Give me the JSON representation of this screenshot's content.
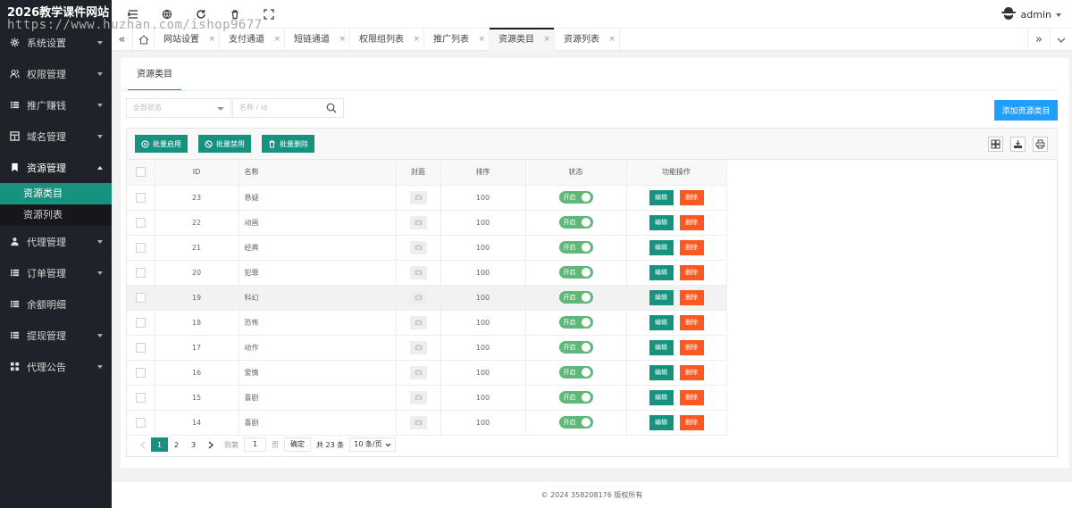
{
  "app": {
    "title": "2026教学课件网站"
  },
  "watermark": "https://www.huzhan.com/ishop9677",
  "user": {
    "name": "admin"
  },
  "sidebar": {
    "items": [
      {
        "label": "系统设置",
        "icon": "gear-icon"
      },
      {
        "label": "权限管理",
        "icon": "users-icon"
      },
      {
        "label": "推广赚钱",
        "icon": "list-icon"
      },
      {
        "label": "域名管理",
        "icon": "grid-icon"
      },
      {
        "label": "资源管理",
        "icon": "bookmark-icon",
        "expanded": true,
        "children": [
          {
            "label": "资源类目",
            "active": true
          },
          {
            "label": "资源列表"
          }
        ]
      },
      {
        "label": "代理管理",
        "icon": "user-group-icon"
      },
      {
        "label": "订单管理",
        "icon": "list-icon"
      },
      {
        "label": "余额明细",
        "icon": "list-icon"
      },
      {
        "label": "提现管理",
        "icon": "list-icon"
      },
      {
        "label": "代理公告",
        "icon": "apps-icon"
      }
    ]
  },
  "tabs": [
    {
      "label": "网站设置"
    },
    {
      "label": "支付通道"
    },
    {
      "label": "短链通道"
    },
    {
      "label": "权限组列表"
    },
    {
      "label": "推广列表"
    },
    {
      "label": "资源类目",
      "active": true
    },
    {
      "label": "资源列表"
    }
  ],
  "tab_close": "×",
  "card": {
    "title": "资源类目"
  },
  "filters": {
    "status_placeholder": "全部状态",
    "name_placeholder": "名称 / id",
    "add_button": "添加资源类目"
  },
  "toolbar": {
    "batch_enable": "批量启用",
    "batch_disable": "批量禁用",
    "batch_delete": "批量删除"
  },
  "table": {
    "headers": {
      "id": "ID",
      "name": "名称",
      "cover": "封面",
      "sort": "排序",
      "status": "状态",
      "actions": "功能操作"
    },
    "rows": [
      {
        "id": "23",
        "name": "悬疑",
        "sort": "100",
        "status": "开启"
      },
      {
        "id": "22",
        "name": "动画",
        "sort": "100",
        "status": "开启"
      },
      {
        "id": "21",
        "name": "经典",
        "sort": "100",
        "status": "开启"
      },
      {
        "id": "20",
        "name": "犯罪",
        "sort": "100",
        "status": "开启"
      },
      {
        "id": "19",
        "name": "科幻",
        "sort": "100",
        "status": "开启",
        "hover": true
      },
      {
        "id": "18",
        "name": "恐怖",
        "sort": "100",
        "status": "开启"
      },
      {
        "id": "17",
        "name": "动作",
        "sort": "100",
        "status": "开启"
      },
      {
        "id": "16",
        "name": "爱情",
        "sort": "100",
        "status": "开启"
      },
      {
        "id": "15",
        "name": "喜剧",
        "sort": "100",
        "status": "开启"
      },
      {
        "id": "14",
        "name": "喜剧",
        "sort": "100",
        "status": "开启"
      }
    ],
    "edit_label": "编辑",
    "delete_label": "删除"
  },
  "pager": {
    "pages": [
      "1",
      "2",
      "3"
    ],
    "current": "1",
    "goto_label": "到第",
    "goto_value": "1",
    "page_unit": "页",
    "confirm": "确定",
    "total": "共 23 条",
    "page_size": "10 条/页"
  },
  "footer": "© 2024 358208176 版权所有",
  "colors": {
    "primary": "#16927f",
    "sidebar_bg": "#20222a",
    "danger": "#ff5722",
    "info": "#1e9fff",
    "switch_on": "#5fb878"
  }
}
